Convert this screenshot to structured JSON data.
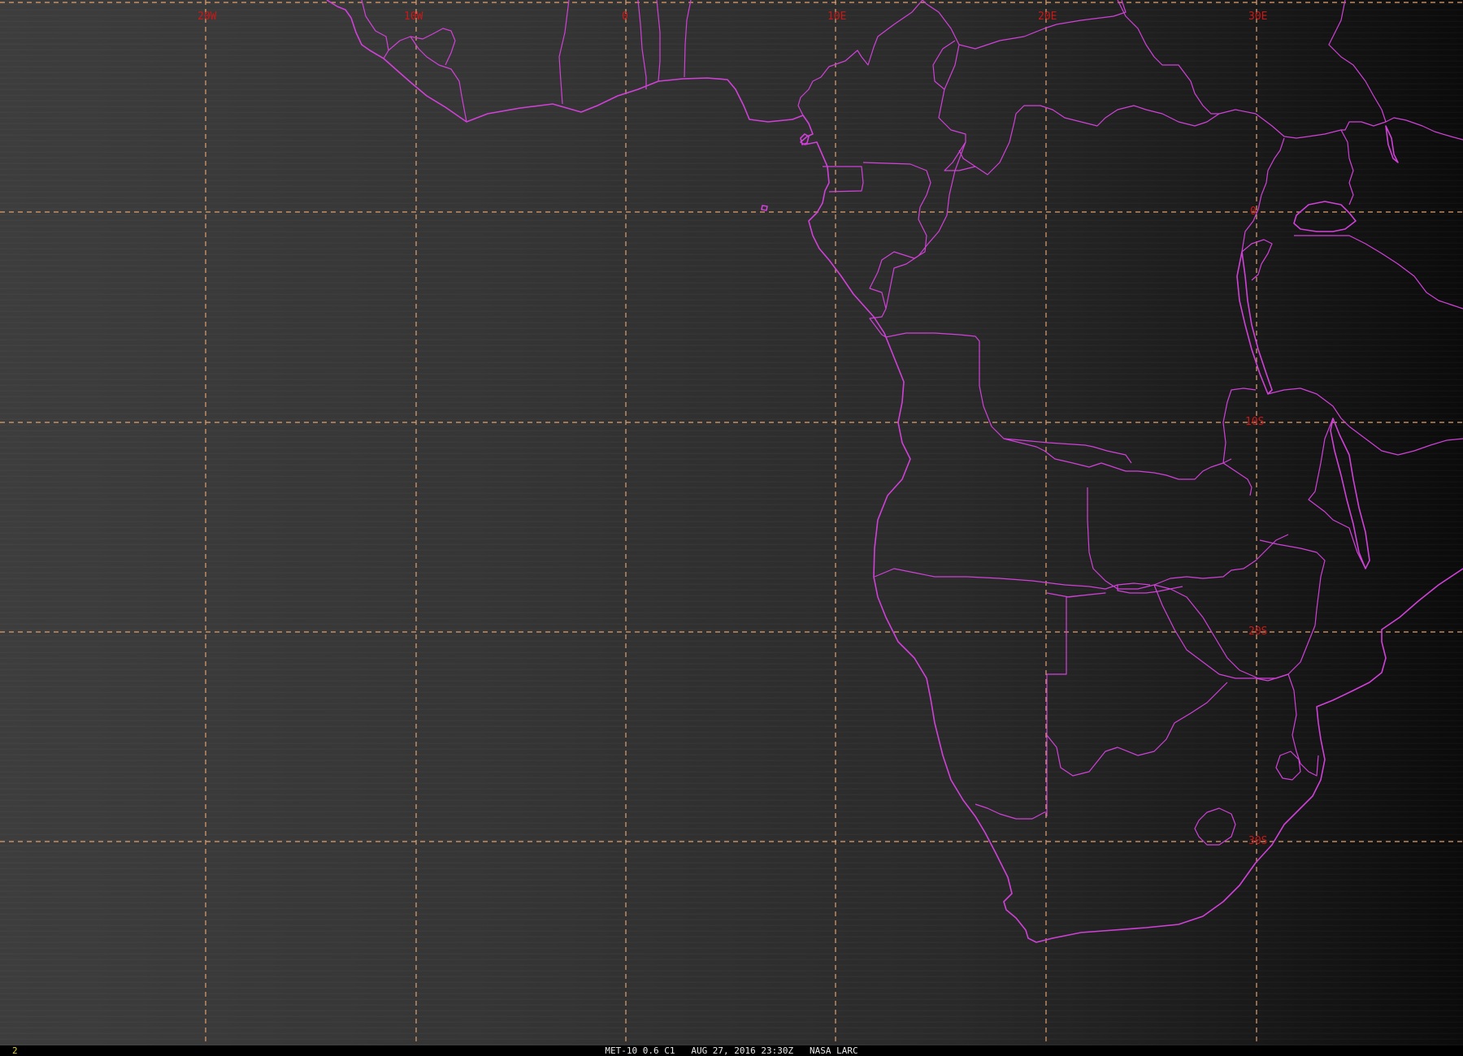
{
  "map": {
    "longitude_labels": [
      "20W",
      "10W",
      "0",
      "10E",
      "20E",
      "30E"
    ],
    "latitude_labels": [
      "0",
      "10S",
      "20S",
      "30S"
    ],
    "colors": {
      "grid": "#e0a070",
      "boundaries": "#d040d8",
      "grid_labels": "#c81818"
    }
  },
  "status": {
    "frame_number": "2",
    "caption": "MET-10 0.6 C1   AUG 27, 2016 23:30Z   NASA LARC"
  }
}
